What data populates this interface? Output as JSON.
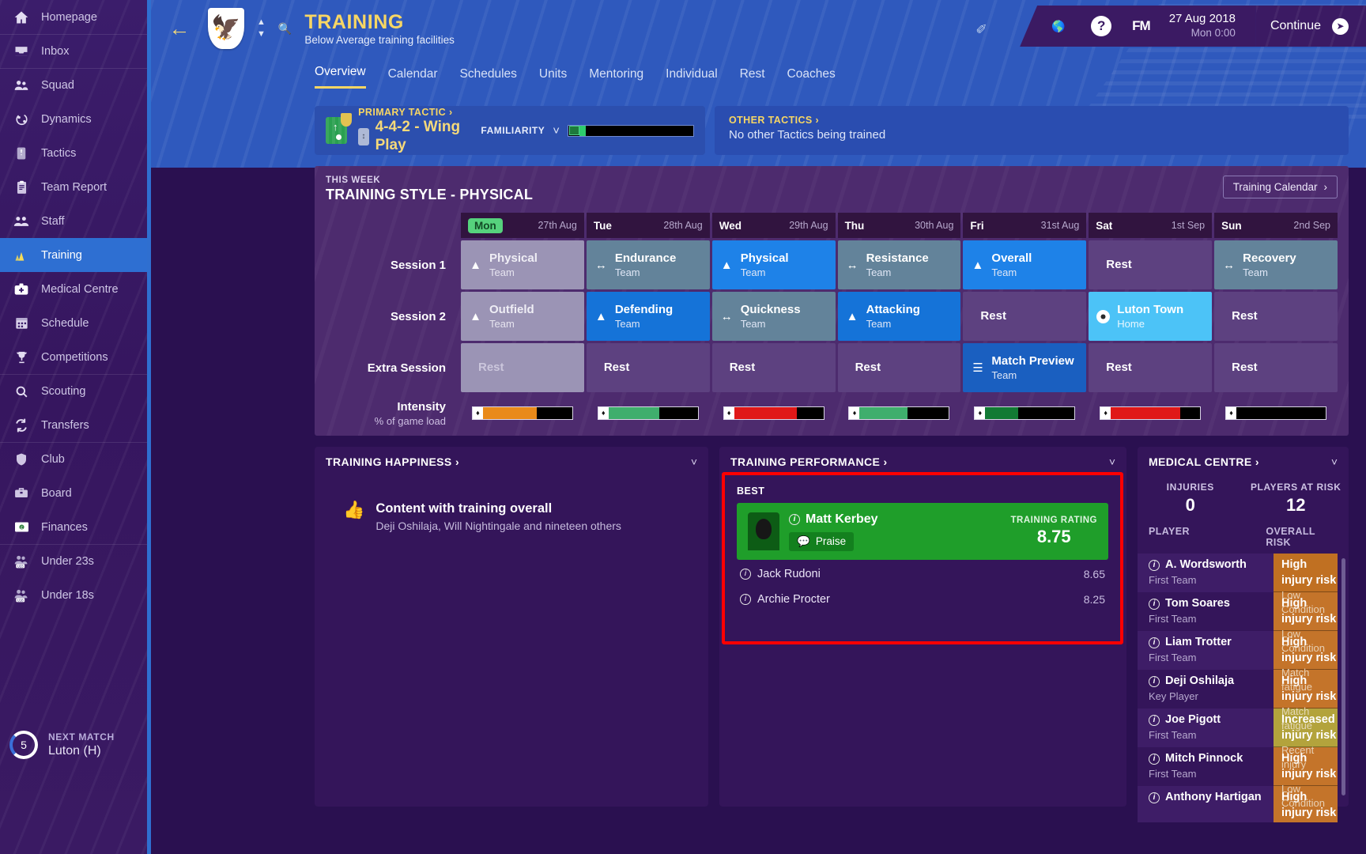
{
  "sidebar": {
    "items": [
      {
        "label": "Homepage",
        "icon": "home-icon",
        "sep": false
      },
      {
        "label": "Inbox",
        "icon": "inbox-icon",
        "sep": true
      },
      {
        "label": "Squad",
        "icon": "squad-icon",
        "sep": true
      },
      {
        "label": "Dynamics",
        "icon": "dynamics-icon",
        "sep": false
      },
      {
        "label": "Tactics",
        "icon": "tactics-icon",
        "sep": false
      },
      {
        "label": "Team Report",
        "icon": "clipboard-icon",
        "sep": false
      },
      {
        "label": "Staff",
        "icon": "staff-icon",
        "sep": false
      },
      {
        "label": "Training",
        "icon": "training-icon",
        "sep": false,
        "active": true
      },
      {
        "label": "Medical Centre",
        "icon": "medical-icon",
        "sep": false
      },
      {
        "label": "Schedule",
        "icon": "calendar-icon",
        "sep": false
      },
      {
        "label": "Competitions",
        "icon": "trophy-icon",
        "sep": false
      },
      {
        "label": "Scouting",
        "icon": "search-icon",
        "sep": true
      },
      {
        "label": "Transfers",
        "icon": "transfers-icon",
        "sep": false
      },
      {
        "label": "Club",
        "icon": "shield-icon",
        "sep": true
      },
      {
        "label": "Board",
        "icon": "briefcase-icon",
        "sep": false
      },
      {
        "label": "Finances",
        "icon": "money-icon",
        "sep": false
      },
      {
        "label": "Under 23s",
        "icon": "u23-icon",
        "sep": true
      },
      {
        "label": "Under 18s",
        "icon": "u18-icon",
        "sep": false
      }
    ],
    "next_match": {
      "title": "NEXT MATCH",
      "value": "Luton (H)",
      "days": "5"
    }
  },
  "header": {
    "back_icon": "back-arrow-icon",
    "title": "TRAINING",
    "subtitle": "Below Average training facilities",
    "date": "27 Aug 2018",
    "time": "Mon 0:00",
    "fm_logo": "FM",
    "continue_label": "Continue",
    "tabs": [
      {
        "label": "Overview",
        "active": true
      },
      {
        "label": "Calendar",
        "active": false
      },
      {
        "label": "Schedules",
        "active": false
      },
      {
        "label": "Units",
        "active": false
      },
      {
        "label": "Mentoring",
        "active": false
      },
      {
        "label": "Individual",
        "active": false
      },
      {
        "label": "Rest",
        "active": false
      },
      {
        "label": "Coaches",
        "active": false
      }
    ]
  },
  "tactic": {
    "primary_label": "PRIMARY TACTIC",
    "primary_name": "4-4-2 - Wing Play",
    "familiarity_label": "FAMILIARITY",
    "other_label": "OTHER TACTICS",
    "other_value": "No other Tactics being trained"
  },
  "training": {
    "this_week": "THIS WEEK",
    "style": "TRAINING STYLE - PHYSICAL",
    "calendar_button": "Training Calendar",
    "days": [
      {
        "name": "Mon",
        "date": "27th Aug",
        "today": true
      },
      {
        "name": "Tue",
        "date": "28th Aug",
        "today": false
      },
      {
        "name": "Wed",
        "date": "29th Aug",
        "today": false
      },
      {
        "name": "Thu",
        "date": "30th Aug",
        "today": false
      },
      {
        "name": "Fri",
        "date": "31st Aug",
        "today": false
      },
      {
        "name": "Sat",
        "date": "1st Sep",
        "today": false
      },
      {
        "name": "Sun",
        "date": "2nd Sep",
        "today": false
      }
    ],
    "row_labels": {
      "s1": "Session 1",
      "s2": "Session 2",
      "extra": "Extra Session",
      "intensity": "Intensity",
      "intensity_sub": "% of game load"
    },
    "session1": [
      {
        "name": "Physical",
        "sub": "Team",
        "style": "c-grey",
        "icon": "physical-icon"
      },
      {
        "name": "Endurance",
        "sub": "Team",
        "style": "c-slate",
        "icon": "endurance-icon"
      },
      {
        "name": "Physical",
        "sub": "Team",
        "style": "c-blue",
        "icon": "physical-icon"
      },
      {
        "name": "Resistance",
        "sub": "Team",
        "style": "c-slate",
        "icon": "endurance-icon"
      },
      {
        "name": "Overall",
        "sub": "Team",
        "style": "c-blue",
        "icon": "physical-icon"
      },
      {
        "name": "Rest",
        "sub": "",
        "style": "c-rest",
        "icon": ""
      },
      {
        "name": "Recovery",
        "sub": "Team",
        "style": "c-slate",
        "icon": "endurance-icon"
      }
    ],
    "session2": [
      {
        "name": "Outfield",
        "sub": "Team",
        "style": "c-grey",
        "icon": "physical-icon"
      },
      {
        "name": "Defending",
        "sub": "Team",
        "style": "c-blue2",
        "icon": "physical-icon"
      },
      {
        "name": "Quickness",
        "sub": "Team",
        "style": "c-slate",
        "icon": "endurance-icon"
      },
      {
        "name": "Attacking",
        "sub": "Team",
        "style": "c-blue2",
        "icon": "physical-icon"
      },
      {
        "name": "Rest",
        "sub": "",
        "style": "c-rest",
        "icon": ""
      },
      {
        "name": "Luton Town",
        "sub": "Home",
        "style": "c-lblue",
        "icon": "match-ball-icon"
      },
      {
        "name": "Rest",
        "sub": "",
        "style": "c-rest",
        "icon": ""
      }
    ],
    "extra": [
      {
        "name": "Rest",
        "sub": "",
        "style": "c-rest-lt",
        "icon": ""
      },
      {
        "name": "Rest",
        "sub": "",
        "style": "c-rest",
        "icon": ""
      },
      {
        "name": "Rest",
        "sub": "",
        "style": "c-rest",
        "icon": ""
      },
      {
        "name": "Rest",
        "sub": "",
        "style": "c-rest",
        "icon": ""
      },
      {
        "name": "Match Preview",
        "sub": "Team",
        "style": "c-dblue",
        "icon": "preview-icon"
      },
      {
        "name": "Rest",
        "sub": "",
        "style": "c-rest",
        "icon": ""
      },
      {
        "name": "Rest",
        "sub": "",
        "style": "c-rest",
        "icon": ""
      }
    ],
    "intensity": [
      {
        "pct": 62,
        "color": "#e98a1a"
      },
      {
        "pct": 58,
        "color": "#3fae6d"
      },
      {
        "pct": 72,
        "color": "#e01818"
      },
      {
        "pct": 55,
        "color": "#3fae6d"
      },
      {
        "pct": 38,
        "color": "#127a34"
      },
      {
        "pct": 80,
        "color": "#e01818"
      },
      {
        "pct": 0,
        "color": "#000000"
      }
    ]
  },
  "happiness": {
    "title": "TRAINING HAPPINESS",
    "main": "Content with training overall",
    "sub": "Deji Oshilaja, Will Nightingale and nineteen others"
  },
  "performance": {
    "title": "TRAINING PERFORMANCE",
    "best_label": "BEST",
    "best_player": "Matt Kerbey",
    "praise_label": "Praise",
    "rating_label": "TRAINING RATING",
    "rating_value": "8.75",
    "rows": [
      {
        "name": "Jack Rudoni",
        "value": "8.65"
      },
      {
        "name": "Archie Procter",
        "value": "8.25"
      }
    ]
  },
  "medical": {
    "title": "MEDICAL CENTRE",
    "stats": [
      {
        "label": "INJURIES",
        "value": "0"
      },
      {
        "label": "PLAYERS AT RISK",
        "value": "12"
      }
    ],
    "columns": {
      "player": "PLAYER",
      "risk": "OVERALL RISK"
    },
    "rows": [
      {
        "player": "A. Wordsworth",
        "role": "First Team",
        "risk": "High injury risk",
        "reason": "Low Condition",
        "risk_class": "risk-high",
        "alt": true
      },
      {
        "player": "Tom Soares",
        "role": "First Team",
        "risk": "High injury risk",
        "reason": "Low Condition",
        "risk_class": "risk-high2",
        "alt": false
      },
      {
        "player": "Liam Trotter",
        "role": "First Team",
        "risk": "High injury risk",
        "reason": "Match fatigue",
        "risk_class": "risk-high2",
        "alt": true
      },
      {
        "player": "Deji Oshilaja",
        "role": "Key Player",
        "risk": "High injury risk",
        "reason": "Match fatigue",
        "risk_class": "risk-high2",
        "alt": false
      },
      {
        "player": "Joe Pigott",
        "role": "First Team",
        "risk": "Increased injury risk",
        "reason": "Recent injury",
        "risk_class": "risk-inc",
        "alt": true
      },
      {
        "player": "Mitch Pinnock",
        "role": "First Team",
        "risk": "High injury risk",
        "reason": "Low Condition",
        "risk_class": "risk-high2",
        "alt": false
      },
      {
        "player": "Anthony Hartigan",
        "role": "",
        "risk": "High injury risk",
        "reason": "",
        "risk_class": "risk-high2",
        "alt": true
      }
    ]
  }
}
